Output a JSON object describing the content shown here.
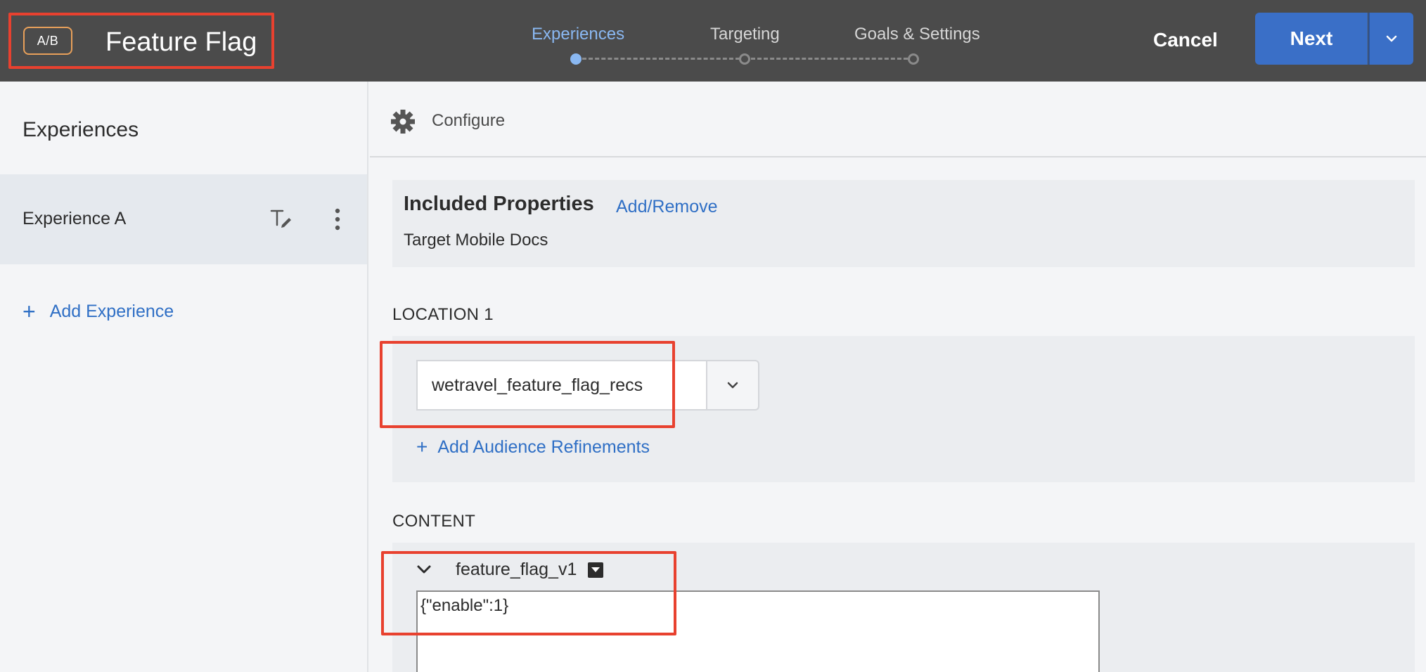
{
  "header": {
    "badge": "A/B",
    "title": "Feature Flag",
    "steps": [
      {
        "label": "Experiences",
        "active": true
      },
      {
        "label": "Targeting",
        "active": false
      },
      {
        "label": "Goals & Settings",
        "active": false
      }
    ],
    "cancel_label": "Cancel",
    "next_label": "Next"
  },
  "sidebar": {
    "title": "Experiences",
    "items": [
      {
        "label": "Experience A"
      }
    ],
    "add_label": "Add Experience"
  },
  "main": {
    "configure_label": "Configure",
    "included_properties": {
      "title": "Included Properties",
      "link": "Add/Remove",
      "value": "Target Mobile Docs"
    },
    "location": {
      "label": "LOCATION 1",
      "value": "wetravel_feature_flag_recs",
      "add_label": "Add Audience Refinements"
    },
    "content": {
      "label": "CONTENT",
      "name": "feature_flag_v1",
      "code": "{\"enable\":1}"
    }
  },
  "colors": {
    "header_bg": "#4b4b4b",
    "accent_blue": "#3a6fc7",
    "active_step": "#8ab8f2",
    "highlight": "#e8412f",
    "link": "#2f6fc5"
  }
}
